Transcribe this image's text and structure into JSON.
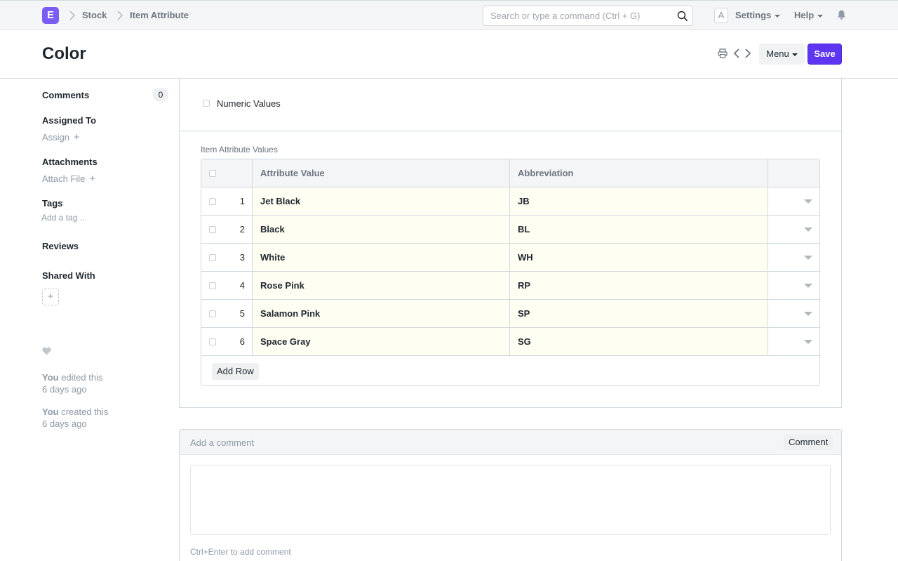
{
  "navbar": {
    "logo_letter": "E",
    "breadcrumbs": [
      "Stock",
      "Item Attribute"
    ],
    "search_placeholder": "Search or type a command (Ctrl + G)",
    "avatar_letter": "A",
    "settings_label": "Settings",
    "help_label": "Help"
  },
  "page": {
    "title": "Color",
    "menu_label": "Menu",
    "save_label": "Save"
  },
  "sidebar": {
    "comments_label": "Comments",
    "comments_count": "0",
    "assigned_to_label": "Assigned To",
    "assign_label": "Assign",
    "attachments_label": "Attachments",
    "attach_file_label": "Attach File",
    "tags_label": "Tags",
    "add_tag_label": "Add a tag ...",
    "reviews_label": "Reviews",
    "shared_with_label": "Shared With",
    "activity": [
      {
        "actor": "You",
        "action": " edited this",
        "time": "6 days ago"
      },
      {
        "actor": "You",
        "action": " created this",
        "time": "6 days ago"
      }
    ]
  },
  "form": {
    "numeric_values_label": "Numeric Values",
    "numeric_values_checked": false,
    "grid_label": "Item Attribute Values",
    "columns": [
      "Attribute Value",
      "Abbreviation"
    ],
    "rows": [
      {
        "idx": "1",
        "value": "Jet Black",
        "abbr": "JB"
      },
      {
        "idx": "2",
        "value": "Black",
        "abbr": "BL"
      },
      {
        "idx": "3",
        "value": "White",
        "abbr": "WH"
      },
      {
        "idx": "4",
        "value": "Rose Pink",
        "abbr": "RP"
      },
      {
        "idx": "5",
        "value": "Salamon Pink",
        "abbr": "SP"
      },
      {
        "idx": "6",
        "value": "Space Gray",
        "abbr": "SG"
      }
    ],
    "add_row_label": "Add Row"
  },
  "comments": {
    "header_label": "Add a comment",
    "button_label": "Comment",
    "hint": "Ctrl+Enter to add comment"
  },
  "colors": {
    "brand": "#5e35f1",
    "row_highlight": "#fefef3"
  }
}
